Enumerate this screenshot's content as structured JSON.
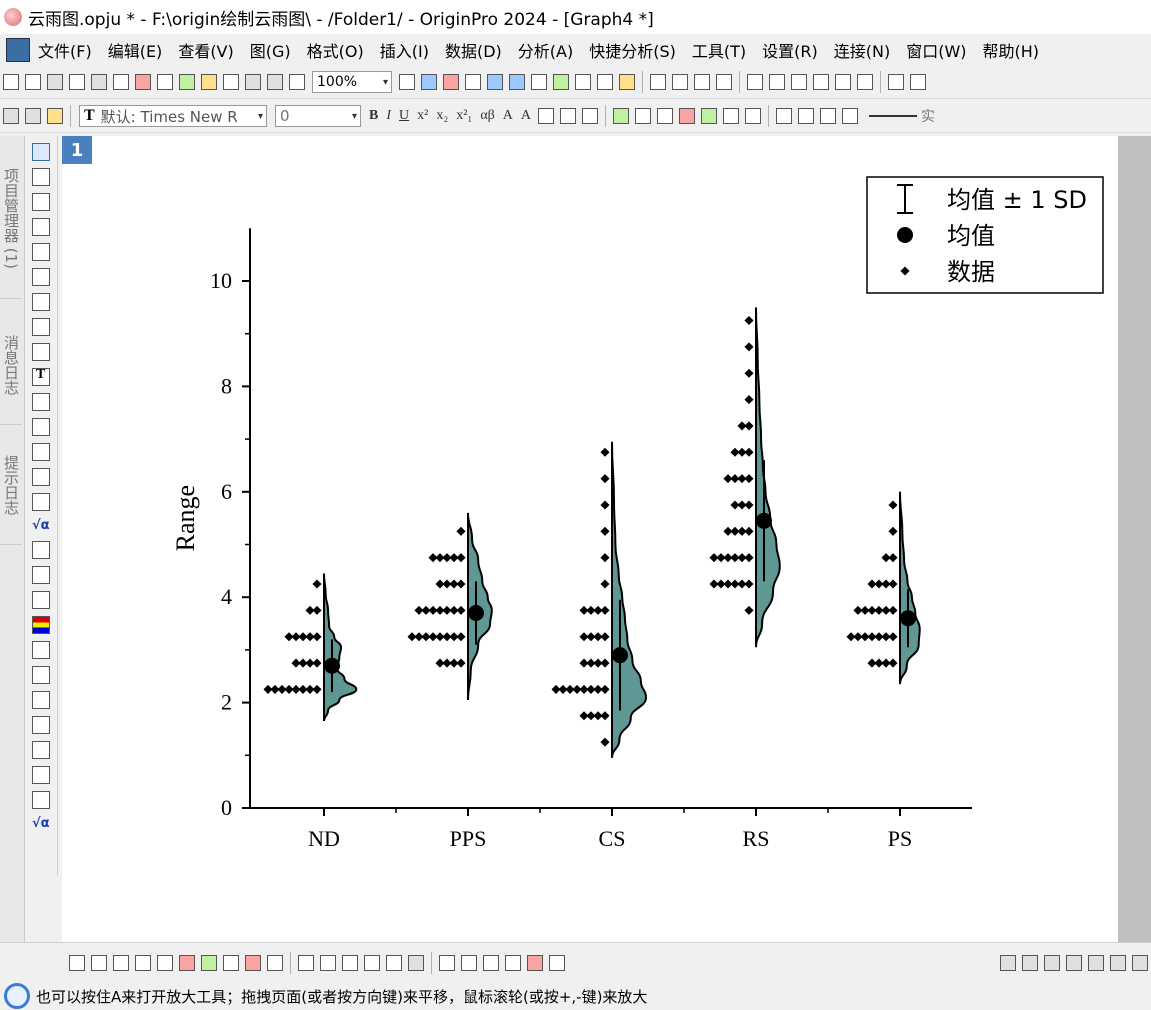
{
  "window": {
    "title": "云雨图.opju * - F:\\origin绘制云雨图\\ - /Folder1/ - OriginPro 2024 - [Graph4 *]"
  },
  "menu": {
    "items": [
      "文件(F)",
      "编辑(E)",
      "查看(V)",
      "图(G)",
      "格式(O)",
      "插入(I)",
      "数据(D)",
      "分析(A)",
      "快捷分析(S)",
      "工具(T)",
      "设置(R)",
      "连接(N)",
      "窗口(W)",
      "帮助(H)"
    ]
  },
  "toolbar": {
    "zoom": "100%",
    "font": "默认: Times New R",
    "font_size": "0",
    "line_style": "实"
  },
  "left_dock": {
    "tabs": [
      "项目管理器 (1)",
      "消息日志",
      "提示日志"
    ]
  },
  "graph": {
    "layer_number": "1"
  },
  "status": {
    "message": "也可以按住A来打开放大工具；拖拽页面(或者按方向键)来平移，鼠标滚轮(或按+,-键)来放大"
  },
  "chart_data": {
    "type": "raincloud",
    "ylabel": "Range",
    "xlabel": "",
    "ylim": [
      0,
      11
    ],
    "yticks": [
      0,
      2,
      4,
      6,
      8,
      10
    ],
    "categories": [
      "ND",
      "PPS",
      "CS",
      "RS",
      "PS"
    ],
    "legend": {
      "position": "top-right",
      "entries": [
        "均值 ± 1 SD",
        "均值",
        "数据"
      ]
    },
    "fill_color": "#5f9794",
    "groups": [
      {
        "name": "ND",
        "mean": 2.7,
        "sd": 0.5,
        "range": [
          1.65,
          4.45
        ],
        "points": [
          {
            "y": 2.25,
            "count": 8
          },
          {
            "y": 2.75,
            "count": 4
          },
          {
            "y": 3.25,
            "count": 5
          },
          {
            "y": 3.75,
            "count": 2
          },
          {
            "y": 4.25,
            "count": 1
          }
        ],
        "density": [
          [
            1.65,
            0
          ],
          [
            1.85,
            0.12
          ],
          [
            2.05,
            0.45
          ],
          [
            2.25,
            0.95
          ],
          [
            2.45,
            0.6
          ],
          [
            2.65,
            0.38
          ],
          [
            2.85,
            0.45
          ],
          [
            3.05,
            0.5
          ],
          [
            3.25,
            0.3
          ],
          [
            3.45,
            0.15
          ],
          [
            3.75,
            0.12
          ],
          [
            4.05,
            0.05
          ],
          [
            4.45,
            0
          ]
        ]
      },
      {
        "name": "PPS",
        "mean": 3.7,
        "sd": 0.6,
        "range": [
          2.05,
          5.6
        ],
        "points": [
          {
            "y": 2.75,
            "count": 4
          },
          {
            "y": 3.25,
            "count": 8
          },
          {
            "y": 3.75,
            "count": 7
          },
          {
            "y": 4.25,
            "count": 4
          },
          {
            "y": 4.75,
            "count": 5
          },
          {
            "y": 5.25,
            "count": 1
          }
        ],
        "density": [
          [
            2.05,
            0
          ],
          [
            2.6,
            0.08
          ],
          [
            3.1,
            0.3
          ],
          [
            3.5,
            0.65
          ],
          [
            3.75,
            0.7
          ],
          [
            4.0,
            0.58
          ],
          [
            4.3,
            0.42
          ],
          [
            4.7,
            0.3
          ],
          [
            5.1,
            0.12
          ],
          [
            5.6,
            0
          ]
        ]
      },
      {
        "name": "CS",
        "mean": 2.9,
        "sd": 1.05,
        "range": [
          0.95,
          6.95
        ],
        "points": [
          {
            "y": 1.25,
            "count": 1
          },
          {
            "y": 1.75,
            "count": 4
          },
          {
            "y": 2.25,
            "count": 8
          },
          {
            "y": 2.75,
            "count": 4
          },
          {
            "y": 3.25,
            "count": 4
          },
          {
            "y": 3.75,
            "count": 4
          },
          {
            "y": 4.25,
            "count": 1
          },
          {
            "y": 4.75,
            "count": 1
          },
          {
            "y": 5.25,
            "count": 1
          },
          {
            "y": 5.75,
            "count": 1
          },
          {
            "y": 6.25,
            "count": 1
          },
          {
            "y": 6.75,
            "count": 1
          }
        ],
        "density": [
          [
            0.95,
            0
          ],
          [
            1.3,
            0.22
          ],
          [
            1.7,
            0.55
          ],
          [
            2.1,
            1.0
          ],
          [
            2.4,
            0.85
          ],
          [
            2.8,
            0.6
          ],
          [
            3.2,
            0.45
          ],
          [
            3.6,
            0.38
          ],
          [
            4.0,
            0.3
          ],
          [
            4.4,
            0.2
          ],
          [
            5.0,
            0.1
          ],
          [
            5.8,
            0.06
          ],
          [
            6.95,
            0
          ]
        ]
      },
      {
        "name": "RS",
        "mean": 5.45,
        "sd": 1.15,
        "range": [
          3.05,
          9.5
        ],
        "points": [
          {
            "y": 3.75,
            "count": 1
          },
          {
            "y": 4.25,
            "count": 6
          },
          {
            "y": 4.75,
            "count": 6
          },
          {
            "y": 5.25,
            "count": 4
          },
          {
            "y": 5.75,
            "count": 3
          },
          {
            "y": 6.25,
            "count": 4
          },
          {
            "y": 6.75,
            "count": 3
          },
          {
            "y": 7.25,
            "count": 2
          },
          {
            "y": 7.75,
            "count": 1
          },
          {
            "y": 8.25,
            "count": 1
          },
          {
            "y": 8.75,
            "count": 1
          },
          {
            "y": 9.25,
            "count": 1
          }
        ],
        "density": [
          [
            3.05,
            0
          ],
          [
            3.5,
            0.18
          ],
          [
            4.1,
            0.5
          ],
          [
            4.6,
            0.7
          ],
          [
            5.0,
            0.6
          ],
          [
            5.5,
            0.42
          ],
          [
            6.0,
            0.28
          ],
          [
            6.5,
            0.2
          ],
          [
            7.0,
            0.15
          ],
          [
            7.7,
            0.1
          ],
          [
            8.5,
            0.05
          ],
          [
            9.5,
            0
          ]
        ]
      },
      {
        "name": "PS",
        "mean": 3.6,
        "sd": 0.55,
        "range": [
          2.35,
          6.0
        ],
        "points": [
          {
            "y": 2.75,
            "count": 4
          },
          {
            "y": 3.25,
            "count": 7
          },
          {
            "y": 3.75,
            "count": 6
          },
          {
            "y": 4.25,
            "count": 4
          },
          {
            "y": 4.75,
            "count": 2
          },
          {
            "y": 5.25,
            "count": 1
          },
          {
            "y": 5.75,
            "count": 1
          }
        ],
        "density": [
          [
            2.35,
            0
          ],
          [
            2.7,
            0.2
          ],
          [
            3.1,
            0.55
          ],
          [
            3.4,
            0.58
          ],
          [
            3.7,
            0.45
          ],
          [
            4.0,
            0.35
          ],
          [
            4.3,
            0.22
          ],
          [
            4.7,
            0.12
          ],
          [
            5.2,
            0.07
          ],
          [
            6.0,
            0
          ]
        ]
      }
    ]
  }
}
